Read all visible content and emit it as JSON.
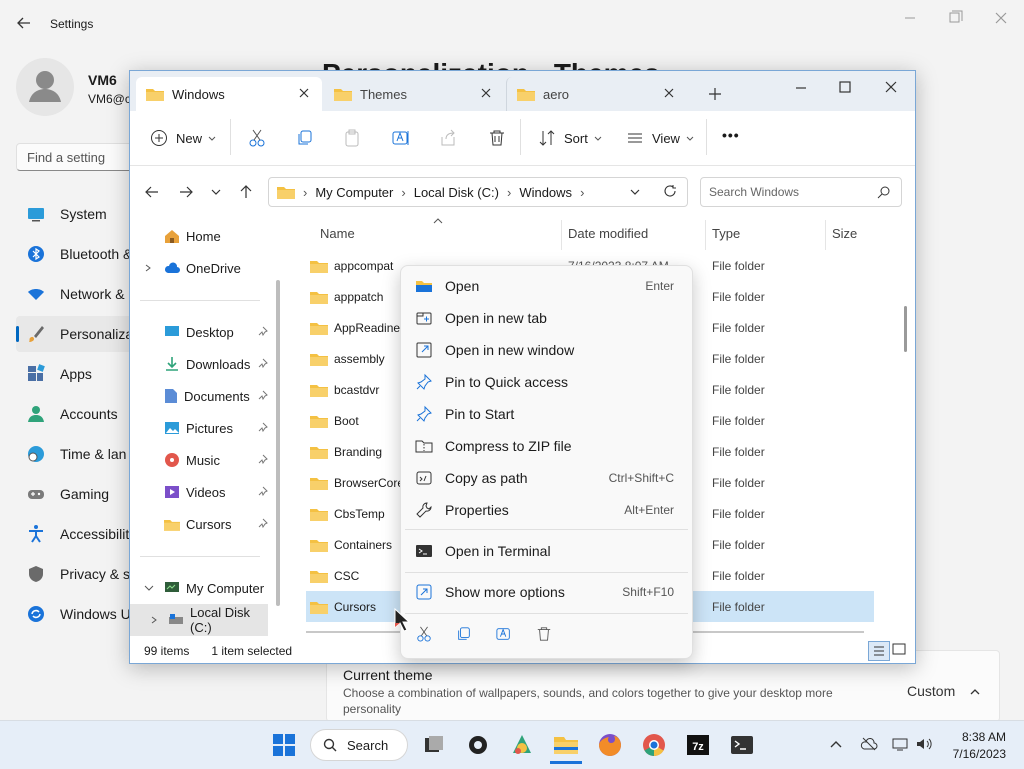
{
  "settings": {
    "title": "Settings",
    "user_name": "VM6",
    "user_email": "VM6@c",
    "find_placeholder": "Find a setting",
    "page_title": "Personalization › Themes",
    "nav": [
      {
        "label": "System",
        "icon": "monitor-icon"
      },
      {
        "label": "Bluetooth &",
        "icon": "bluetooth-icon"
      },
      {
        "label": "Network &",
        "icon": "wifi-icon"
      },
      {
        "label": "Personaliza",
        "icon": "brush-icon"
      },
      {
        "label": "Apps",
        "icon": "apps-icon"
      },
      {
        "label": "Accounts",
        "icon": "person-icon"
      },
      {
        "label": "Time & lan",
        "icon": "clock-globe-icon"
      },
      {
        "label": "Gaming",
        "icon": "gamepad-icon"
      },
      {
        "label": "Accessibilit",
        "icon": "accessibility-icon"
      },
      {
        "label": "Privacy & s",
        "icon": "shield-icon"
      },
      {
        "label": "Windows U",
        "icon": "update-icon"
      }
    ],
    "current_theme": {
      "title": "Current theme",
      "desc": "Choose a combination of wallpapers, sounds, and colors together to give your desktop more personality",
      "value": "Custom"
    }
  },
  "explorer": {
    "tabs": [
      {
        "label": "Windows",
        "active": true
      },
      {
        "label": "Themes",
        "active": false
      },
      {
        "label": "aero",
        "active": false
      }
    ],
    "toolbar": {
      "new": "New",
      "sort": "Sort",
      "view": "View",
      "more": "•••"
    },
    "breadcrumb": [
      "My Computer",
      "Local Disk (C:)",
      "Windows"
    ],
    "search_placeholder": "Search Windows",
    "nav_pane": {
      "home": "Home",
      "onedrive": "OneDrive",
      "quick": [
        "Desktop",
        "Downloads",
        "Documents",
        "Pictures",
        "Music",
        "Videos",
        "Cursors"
      ],
      "my_computer": "My Computer",
      "local_disk": "Local Disk (C:)"
    },
    "columns": {
      "name": "Name",
      "date": "Date modified",
      "type": "Type",
      "size": "Size"
    },
    "rows": [
      {
        "name": "appcompat",
        "date": "7/16/2023 8:07 AM",
        "type": "File folder"
      },
      {
        "name": "apppatch",
        "type": "File folder"
      },
      {
        "name": "AppReadiness",
        "type": "File folder"
      },
      {
        "name": "assembly",
        "type": "File folder"
      },
      {
        "name": "bcastdvr",
        "type": "File folder"
      },
      {
        "name": "Boot",
        "type": "File folder"
      },
      {
        "name": "Branding",
        "type": "File folder"
      },
      {
        "name": "BrowserCore",
        "type": "File folder"
      },
      {
        "name": "CbsTemp",
        "type": "File folder"
      },
      {
        "name": "Containers",
        "type": "File folder"
      },
      {
        "name": "CSC",
        "type": "File folder"
      },
      {
        "name": "Cursors",
        "type": "File folder",
        "selected": true
      }
    ],
    "status": {
      "items": "99 items",
      "selected": "1 item selected"
    }
  },
  "context_menu": {
    "items": [
      {
        "label": "Open",
        "shortcut": "Enter",
        "icon": "open-folder-icon"
      },
      {
        "label": "Open in new tab",
        "shortcut": "",
        "icon": "new-tab-icon"
      },
      {
        "label": "Open in new window",
        "shortcut": "",
        "icon": "new-window-icon"
      },
      {
        "label": "Pin to Quick access",
        "shortcut": "",
        "icon": "pin-icon"
      },
      {
        "label": "Pin to Start",
        "shortcut": "",
        "icon": "pin-start-icon"
      },
      {
        "label": "Compress to ZIP file",
        "shortcut": "",
        "icon": "zip-icon"
      },
      {
        "label": "Copy as path",
        "shortcut": "Ctrl+Shift+C",
        "icon": "copy-path-icon"
      },
      {
        "label": "Properties",
        "shortcut": "Alt+Enter",
        "icon": "wrench-icon"
      }
    ],
    "terminal": {
      "label": "Open in Terminal",
      "icon": "terminal-icon"
    },
    "more": {
      "label": "Show more options",
      "shortcut": "Shift+F10",
      "icon": "more-options-icon"
    }
  },
  "taskbar": {
    "search_label": "Search",
    "time": "8:38 AM",
    "date": "7/16/2023"
  },
  "colors": {
    "accent": "#0067c0",
    "selection": "#cce4f7",
    "folder": "#f4c143"
  }
}
